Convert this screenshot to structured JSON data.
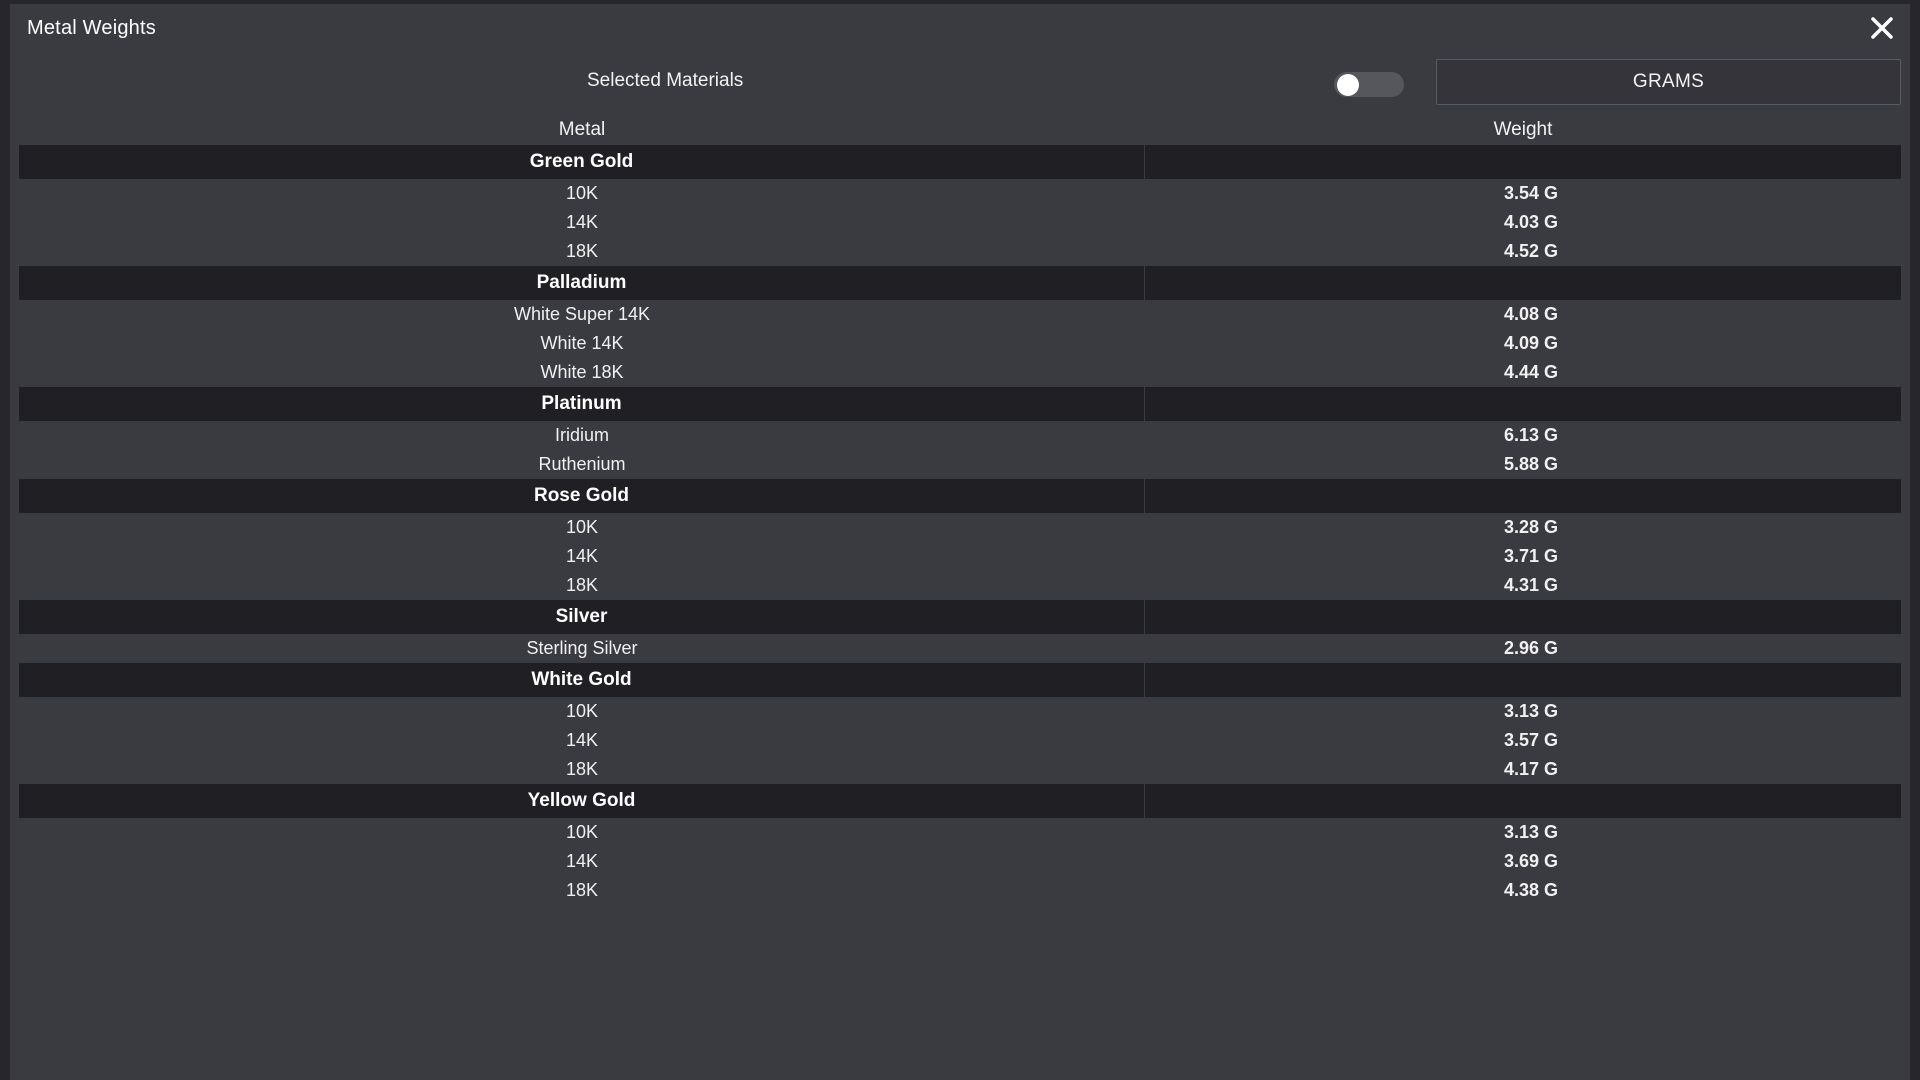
{
  "window": {
    "title": "Metal Weights"
  },
  "controls": {
    "selected_materials_label": "Selected Materials",
    "toggle_on": false,
    "unit_button_label": "GRAMS"
  },
  "table": {
    "headers": {
      "metal": "Metal",
      "weight": "Weight"
    },
    "groups": [
      {
        "name": "Green Gold",
        "items": [
          {
            "metal": "10K",
            "weight": "3.54 G"
          },
          {
            "metal": "14K",
            "weight": "4.03 G"
          },
          {
            "metal": "18K",
            "weight": "4.52 G"
          }
        ]
      },
      {
        "name": "Palladium",
        "items": [
          {
            "metal": "White Super 14K",
            "weight": "4.08 G"
          },
          {
            "metal": "White 14K",
            "weight": "4.09 G"
          },
          {
            "metal": "White 18K",
            "weight": "4.44 G"
          }
        ]
      },
      {
        "name": "Platinum",
        "items": [
          {
            "metal": "Iridium",
            "weight": "6.13 G"
          },
          {
            "metal": "Ruthenium",
            "weight": "5.88 G"
          }
        ]
      },
      {
        "name": "Rose Gold",
        "items": [
          {
            "metal": "10K",
            "weight": "3.28 G"
          },
          {
            "metal": "14K",
            "weight": "3.71 G"
          },
          {
            "metal": "18K",
            "weight": "4.31 G"
          }
        ]
      },
      {
        "name": "Silver",
        "items": [
          {
            "metal": "Sterling Silver",
            "weight": "2.96 G"
          }
        ]
      },
      {
        "name": "White Gold",
        "items": [
          {
            "metal": "10K",
            "weight": "3.13 G"
          },
          {
            "metal": "14K",
            "weight": "3.57 G"
          },
          {
            "metal": "18K",
            "weight": "4.17 G"
          }
        ]
      },
      {
        "name": "Yellow Gold",
        "items": [
          {
            "metal": "10K",
            "weight": "3.13 G"
          },
          {
            "metal": "14K",
            "weight": "3.69 G"
          },
          {
            "metal": "18K",
            "weight": "4.38 G"
          }
        ]
      }
    ]
  },
  "colors": {
    "window_bg": "#3a3a41",
    "group_row_bg": "#202024",
    "text": "#ffffff"
  }
}
